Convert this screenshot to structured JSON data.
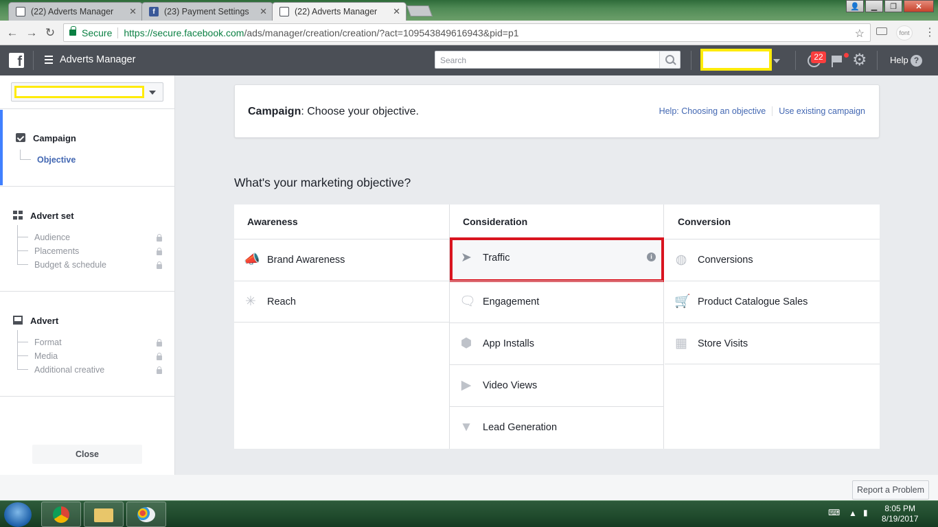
{
  "browser": {
    "tabs": [
      {
        "title": "(22) Adverts Manager",
        "active": false
      },
      {
        "title": "(23) Payment Settings",
        "active": false
      },
      {
        "title": "(22) Adverts Manager",
        "active": true
      }
    ],
    "security_label": "Secure",
    "url_host": "https://secure.facebook.com",
    "url_path": "/ads/manager/creation/creation/?act=109543849616943&pid=p1",
    "ext_font_label": "font"
  },
  "header": {
    "app_title": "Adverts Manager",
    "search_placeholder": "Search",
    "notifications_count": "22",
    "help_label": "Help",
    "help_icon": "?"
  },
  "sidebar": {
    "sections": [
      {
        "title": "Campaign",
        "items": [
          {
            "label": "Objective",
            "active": true,
            "locked": false
          }
        ]
      },
      {
        "title": "Advert set",
        "items": [
          {
            "label": "Audience",
            "locked": true
          },
          {
            "label": "Placements",
            "locked": true
          },
          {
            "label": "Budget & schedule",
            "locked": true
          }
        ]
      },
      {
        "title": "Advert",
        "items": [
          {
            "label": "Format",
            "locked": true
          },
          {
            "label": "Media",
            "locked": true
          },
          {
            "label": "Additional creative",
            "locked": true
          }
        ]
      }
    ],
    "close_label": "Close"
  },
  "campaign_card": {
    "title_bold": "Campaign",
    "title_rest": ": Choose your objective.",
    "help_link": "Help: Choosing an objective",
    "existing_link": "Use existing campaign"
  },
  "objectives": {
    "question": "What's your marketing objective?",
    "columns": [
      {
        "heading": "Awareness",
        "items": [
          {
            "label": "Brand Awareness",
            "icon": "megaphone-icon"
          },
          {
            "label": "Reach",
            "icon": "reach-icon"
          }
        ]
      },
      {
        "heading": "Consideration",
        "items": [
          {
            "label": "Traffic",
            "icon": "cursor-icon",
            "selected": true
          },
          {
            "label": "Engagement",
            "icon": "chat-bubbles-icon"
          },
          {
            "label": "App Installs",
            "icon": "cube-icon"
          },
          {
            "label": "Video Views",
            "icon": "video-camera-icon"
          },
          {
            "label": "Lead Generation",
            "icon": "funnel-icon"
          }
        ]
      },
      {
        "heading": "Conversion",
        "items": [
          {
            "label": "Conversions",
            "icon": "globe-icon"
          },
          {
            "label": "Product Catalogue Sales",
            "icon": "cart-icon"
          },
          {
            "label": "Store Visits",
            "icon": "store-icon"
          }
        ]
      }
    ]
  },
  "footer": {
    "report_label": "Report a Problem"
  },
  "taskbar": {
    "time": "8:05 PM",
    "date": "8/19/2017"
  },
  "colors": {
    "highlight_yellow": "#ffeb0a",
    "selected_border": "#d9141f",
    "fb_header": "#4b4f56",
    "link_blue": "#4267b2"
  }
}
